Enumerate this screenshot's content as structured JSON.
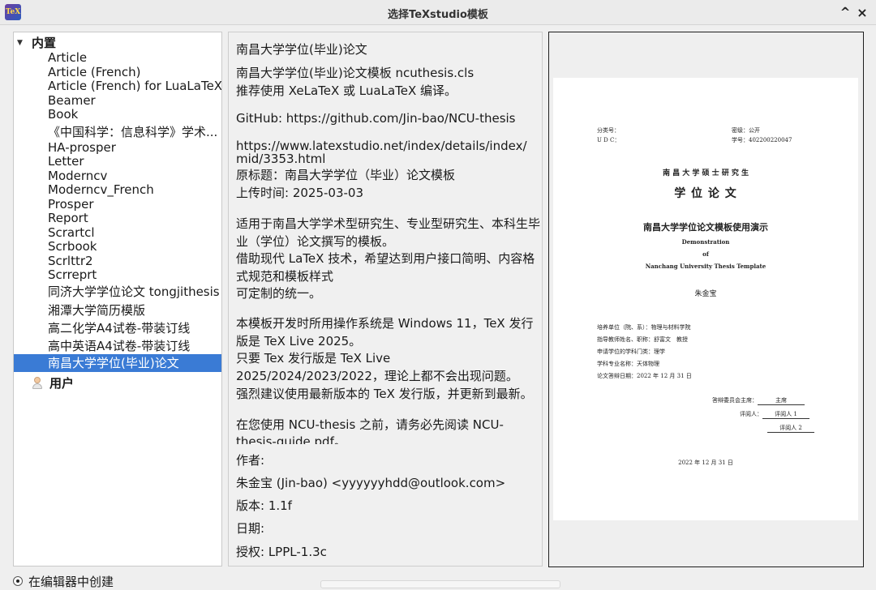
{
  "window": {
    "title": "选择TeXstudio模板",
    "app_icon_text": "TeX",
    "minimize_glyph": "^",
    "close_glyph": "×"
  },
  "tree": {
    "builtin_label": "内置",
    "builtin_items": [
      "Article",
      "Article (French)",
      "Article (French) for LuaLaTeX",
      "Beamer",
      "Book",
      "《中国科学：信息科学》学术...",
      "HA-prosper",
      "Letter",
      "Moderncv",
      "Moderncv_French",
      "Prosper",
      "Report",
      "Scrartcl",
      "Scrbook",
      "Scrlttr2",
      "Scrreprt",
      "同济大学学位论文 tongjithesis",
      "湘潭大学简历模版",
      "高二化学A4试卷-带装订线",
      "高中英语A4试卷-带装订线",
      "南昌大学学位(毕业)论文"
    ],
    "user_label": "用户"
  },
  "description": {
    "lines": [
      "南昌大学学位(毕业)论文",
      "南昌大学学位(毕业)论文模板 ncuthesis.cls",
      "推荐使用 XeLaTeX 或 LuaLaTeX 编译。",
      "GitHub: https://github.com/Jin-bao/NCU-thesis",
      "  https://www.latexstudio.net/index/details/index/",
      "mid/3353.html",
      "原标题：南昌大学学位（毕业）论文模板",
      "上传时间: 2025-03-03",
      "适用于南昌大学学术型研究生、专业型研究生、本科生毕",
      "业（学位）论文撰写的模板。",
      "借助现代 LaTeX 技术，希望达到用户接口简明、内容格",
      "式规范和模板样式",
      " 可定制的统一。",
      " 本模板开发时所用操作系统是 Windows 11，TeX 发行",
      "版是 TeX Live 2025。",
      " 只要 Tex 发行版是 TeX Live",
      "2025/2024/2023/2022，理论上都不会出现问题。",
      " 强烈建议使用最新版本的 TeX 发行版，并更新到最新。",
      " 在您使用 NCU-thesis 之前，请务必先阅读 NCU-",
      "thesis-guide.pdf。"
    ],
    "author_label": "作者:",
    "author_value": "朱金宝 (Jin-bao) <yyyyyyhdd@outlook.com>",
    "version": "版本: 1.1f",
    "date_label": "日期:",
    "license": "授权: LPPL-1.3c"
  },
  "preview": {
    "class_label": "分类号：",
    "udc_label": "U D C：",
    "secret_label": "密级：",
    "secret_value": "公开",
    "student_id_label": "学号：",
    "student_id_value": "402200220047",
    "univ_line": "南 昌 大 学 硕 士 研 究 生",
    "degree_title": "学 位 论 文",
    "thesis_title": "南昌大学学位论文模板使用演示",
    "en_1": "Demonstration",
    "en_2": "of",
    "en_3": "Nanchang University Thesis Template",
    "author": "朱金宝",
    "info": [
      "培养单位（院、系）：物理与材料学院",
      "指导教师姓名、职称：舒富文　教授",
      "申请学位的学科门类：理学",
      "学科专业名称：天体物理",
      "论文答辩日期：2022 年 12 月 31 日"
    ],
    "committee_chair_label": "答辩委员会主席：",
    "committee_chair_value": "主席",
    "reviewer_label": "评阅人：",
    "reviewer_1": "评阅人 1",
    "reviewer_2": "评阅人 2",
    "date": "2022 年 12 月 31 日"
  },
  "bottom": {
    "radio_label": "在编辑器中创建"
  }
}
